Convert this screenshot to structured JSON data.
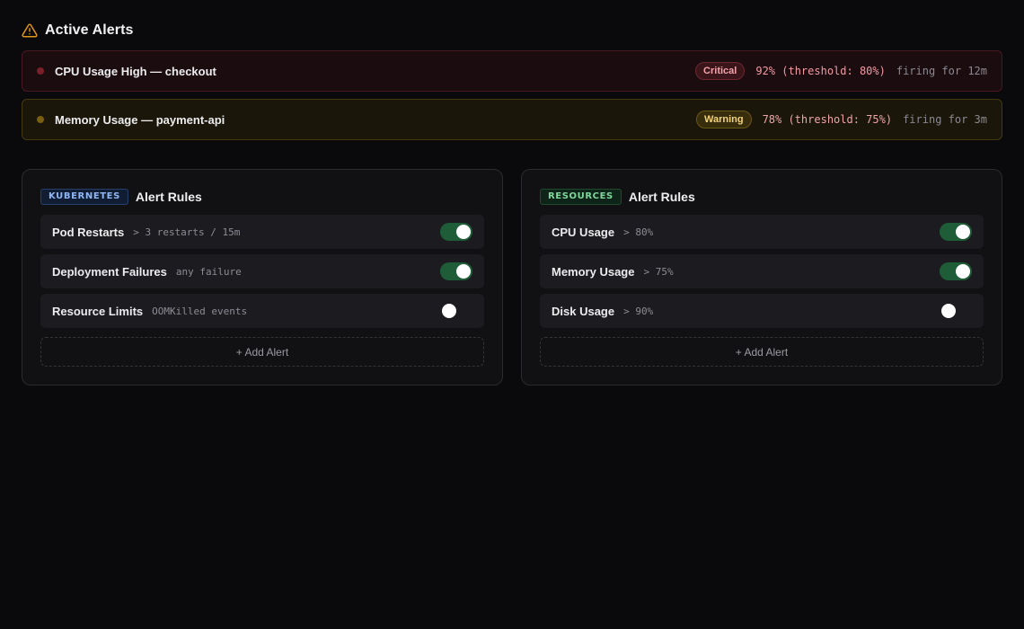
{
  "header": {
    "title": "Active Alerts",
    "icon": "warning-triangle-icon",
    "icon_color": "#e0951b"
  },
  "active_alerts": [
    {
      "severity": "critical",
      "name": "CPU Usage High — checkout",
      "badge": "Critical",
      "metric": "92% (threshold: 80%)",
      "firing": "firing for 12m"
    },
    {
      "severity": "warning",
      "name": "Memory Usage — payment-api",
      "badge": "Warning",
      "metric": "78% (threshold: 75%)",
      "firing": "firing for 3m"
    }
  ],
  "panels": [
    {
      "tag": "KUBERNETES",
      "title": "Alert Rules",
      "rules": [
        {
          "name": "Pod Restarts",
          "condition": "> 3 restarts / 15m",
          "enabled": true
        },
        {
          "name": "Deployment Failures",
          "condition": "any failure",
          "enabled": true
        },
        {
          "name": "Resource Limits",
          "condition": "OOMKilled events",
          "enabled": false
        }
      ],
      "add_label": "+ Add Alert"
    },
    {
      "tag": "RESOURCES",
      "title": "Alert Rules",
      "rules": [
        {
          "name": "CPU Usage",
          "condition": "> 80%",
          "enabled": true
        },
        {
          "name": "Memory Usage",
          "condition": "> 75%",
          "enabled": true
        },
        {
          "name": "Disk Usage",
          "condition": "> 90%",
          "enabled": false
        }
      ],
      "add_label": "+ Add Alert"
    }
  ],
  "colors": {
    "critical": "#f19aa3",
    "warning": "#f2d27a",
    "toggle_on": "#1e5d37",
    "kubernetes_tag": "#8fb6f5",
    "resources_tag": "#7fd79c"
  }
}
